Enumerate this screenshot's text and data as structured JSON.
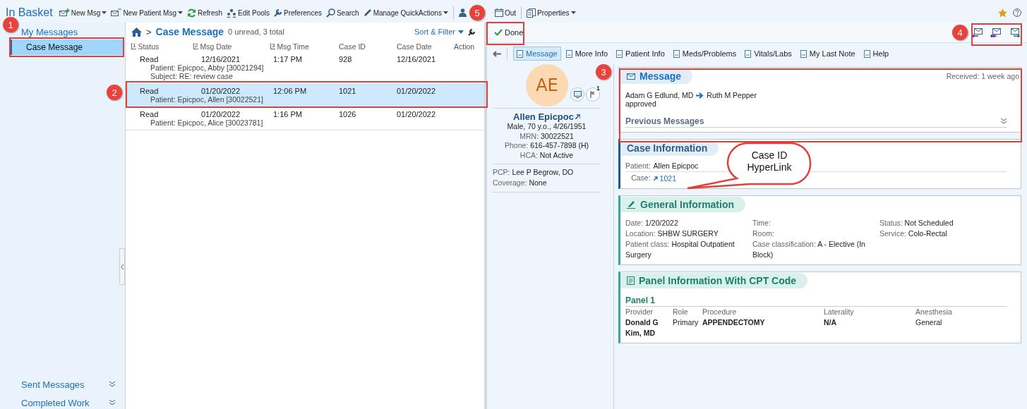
{
  "toolbar": {
    "title": "In Basket",
    "groups": [
      [
        {
          "label": "New Msg",
          "dropdown": true
        },
        {
          "label": "New Patient Msg",
          "dropdown": true
        },
        {
          "label": "Refresh",
          "dropdown": false
        },
        {
          "label": "Edit Pools",
          "dropdown": false
        },
        {
          "label": "Preferences",
          "dropdown": false
        },
        {
          "label": "Search",
          "dropdown": false
        },
        {
          "label": "Manage QuickActions",
          "dropdown": true
        }
      ],
      [
        {
          "dropdown": false
        },
        {
          "label": "Out",
          "dropdown": false
        }
      ],
      [
        {
          "label": "Properties",
          "dropdown": true
        }
      ]
    ]
  },
  "sidebar": {
    "heading": "My Messages",
    "items": [
      {
        "label": "Case Message",
        "selected": true
      }
    ],
    "sections": [
      {
        "label": "Sent Messages"
      },
      {
        "label": "Completed Work"
      }
    ]
  },
  "message_list": {
    "separator": ">",
    "folder": "Case Message",
    "counts": "0 unread, 3 total",
    "sort_filter": "Sort & Filter",
    "columns": [
      {
        "label": "Status",
        "sort_order": "1"
      },
      {
        "label": "Msg Date",
        "sort_order": "2"
      },
      {
        "label": "Msg Time",
        "sort_order": "3"
      },
      {
        "label": "Case ID"
      },
      {
        "label": "Case Date"
      },
      {
        "label": "Action"
      }
    ],
    "rows": [
      {
        "status": "Read",
        "msg_date": "12/16/2021",
        "msg_time": "1:17 PM",
        "case_id": "928",
        "case_date": "12/16/2021",
        "details": [
          "Patient: Epicpoc, Abby [30021294]",
          "Subject: RE: review case"
        ],
        "selected": false
      },
      {
        "status": "Read",
        "msg_date": "01/20/2022",
        "msg_time": "12:06 PM",
        "case_id": "1021",
        "case_date": "01/20/2022",
        "details": [
          "Patient: Epicpoc, Allen [30022521]"
        ],
        "selected": true
      },
      {
        "status": "Read",
        "msg_date": "01/20/2022",
        "msg_time": "1:16 PM",
        "case_id": "1026",
        "case_date": "01/20/2022",
        "details": [
          "Patient: Epicpoc, Alice [30023781]"
        ],
        "selected": false
      }
    ]
  },
  "detail": {
    "done": "Done",
    "tabs": [
      {
        "label": "Message",
        "selected": true
      },
      {
        "label": "More Info",
        "selected": false
      },
      {
        "label": "Patient Info",
        "selected": false
      },
      {
        "label": "Meds/Problems",
        "selected": false
      },
      {
        "label": "Vitals/Labs",
        "selected": false
      },
      {
        "label": "My Last Note",
        "selected": false
      },
      {
        "label": "Help",
        "selected": false
      }
    ],
    "patient": {
      "initials": "AE",
      "flag_count": "1",
      "name": "Allen Epicpoc",
      "lines": [
        {
          "value": "Male, 70 y.o., 4/26/1951"
        },
        {
          "label": "MRN:",
          "value": "30022521"
        },
        {
          "label": "Phone:",
          "value": "616-457-7898 (H)"
        },
        {
          "label": "HCA:",
          "value": "Not Active"
        }
      ],
      "extra": [
        {
          "label": "PCP:",
          "value": "Lee P Begrow, DO"
        },
        {
          "label": "Coverage:",
          "value": "None"
        }
      ]
    },
    "message": {
      "title": "Message",
      "received": "Received: 1 week ago",
      "from": "Adam G Edlund, MD",
      "to": "Ruth M Pepper",
      "body": "approved",
      "previous": "Previous Messages"
    },
    "case_information": {
      "title": "Case Information",
      "fields": [
        {
          "label": "Patient:",
          "value": "Allen Epicpoc",
          "kind": "text"
        },
        {
          "label": "Case:",
          "value": "1021",
          "kind": "link"
        }
      ]
    },
    "general_information": {
      "title": "General Information",
      "columns": [
        [
          {
            "label": "Date:",
            "value": "1/20/2022"
          },
          {
            "label": "Location:",
            "value": "SHBW SURGERY"
          },
          {
            "label": "Patient class:",
            "value": "Hospital Outpatient Surgery"
          }
        ],
        [
          {
            "label": "Time:"
          },
          {
            "label": "Room:"
          },
          {
            "label": "Case classification:",
            "value": "A - Elective (In Block)"
          }
        ],
        [
          {
            "label": "Status:",
            "value": "Not Scheduled"
          },
          {
            "label": "Service:",
            "value": "Colo-Rectal"
          }
        ]
      ]
    },
    "panel_information": {
      "title": "Panel Information With CPT Code",
      "panels": [
        {
          "name": "Panel 1",
          "columns": [
            "Provider",
            "Role",
            "Procedure",
            "Laterality",
            "Anesthesia"
          ],
          "rows": [
            [
              "Donald G Kim, MD",
              "Primary",
              "APPENDECTOMY",
              "N/A",
              "General"
            ]
          ]
        }
      ]
    }
  },
  "annotations": {
    "markers": [
      "1",
      "2",
      "3",
      "4",
      "5"
    ],
    "callout": [
      "Case ID",
      "HyperLink"
    ]
  }
}
